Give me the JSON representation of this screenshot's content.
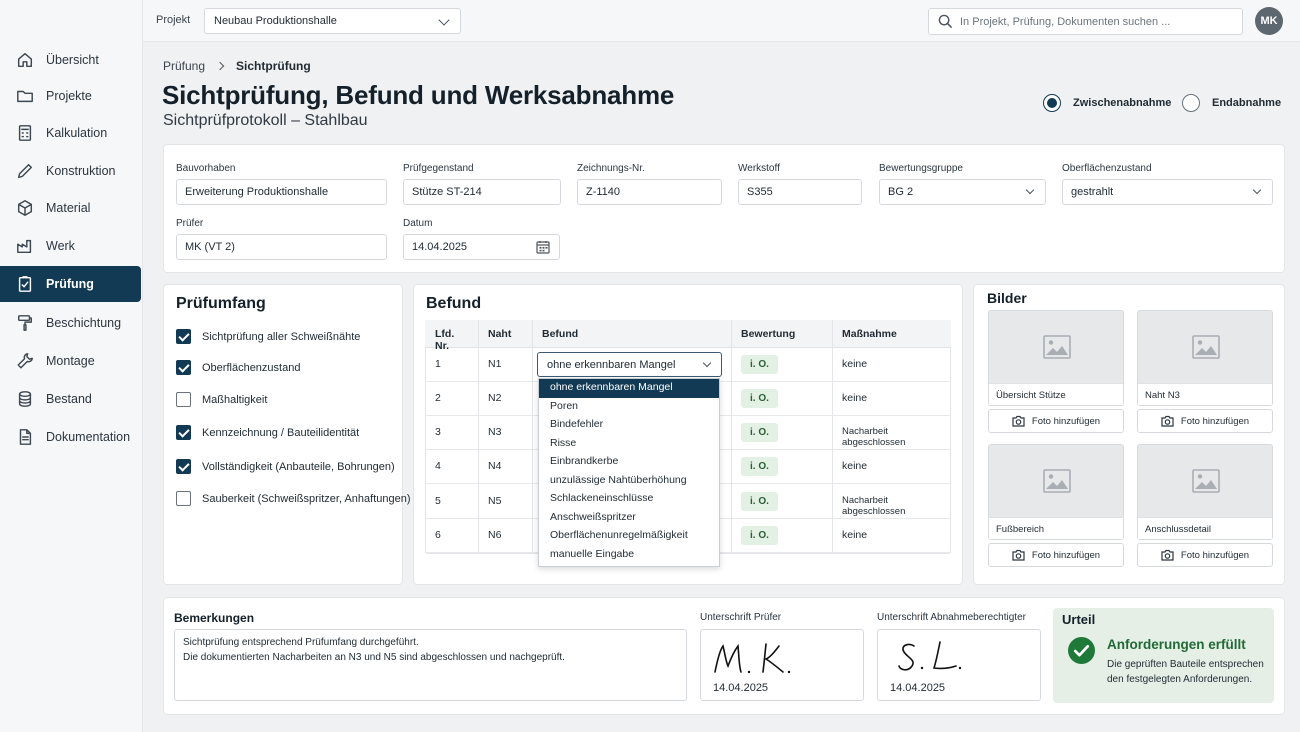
{
  "sidebar": {
    "items": [
      {
        "label": "Übersicht",
        "icon": "home-icon"
      },
      {
        "label": "Projekte",
        "icon": "folder-icon"
      },
      {
        "label": "Kalkulation",
        "icon": "calculator-icon"
      },
      {
        "label": "Konstruktion",
        "icon": "pencil-icon"
      },
      {
        "label": "Material",
        "icon": "cube-icon"
      },
      {
        "label": "Werk",
        "icon": "factory-icon"
      },
      {
        "label": "Prüfung",
        "icon": "clipboard-check-icon"
      },
      {
        "label": "Beschichtung",
        "icon": "paint-roller-icon"
      },
      {
        "label": "Montage",
        "icon": "wrench-icon"
      },
      {
        "label": "Bestand",
        "icon": "database-icon"
      },
      {
        "label": "Dokumentation",
        "icon": "document-icon"
      }
    ],
    "active_index": 6
  },
  "topbar": {
    "project_label": "Projekt",
    "project_value": "Neubau Produktionshalle",
    "search_placeholder": "In Projekt, Prüfung, Dokumenten suchen ...",
    "avatar_initials": "MK"
  },
  "header": {
    "breadcrumb_parent": "Prüfung",
    "breadcrumb_current": "Sichtprüfung",
    "title": "Sichtprüfung, Befund und Werksabnahme",
    "subtitle": "Sichtprüfprotokoll – Stahlbau",
    "radio_options": [
      {
        "label": "Zwischenabnahme",
        "selected": true
      },
      {
        "label": "Endabnahme",
        "selected": false
      }
    ]
  },
  "form": {
    "bauvorhaben_label": "Bauvorhaben",
    "bauvorhaben_value": "Erweiterung Produktionshalle",
    "pruefgegenstand_label": "Prüfgegenstand",
    "pruefgegenstand_value": "Stütze ST-214",
    "zeichnung_label": "Zeichnungs-Nr.",
    "zeichnung_value": "Z-1140",
    "werkstoff_label": "Werkstoff",
    "werkstoff_value": "S355",
    "bewertungsgruppe_label": "Bewertungsgruppe",
    "bewertungsgruppe_value": "BG 2",
    "oberflaeche_label": "Oberflächenzustand",
    "oberflaeche_value": "gestrahlt",
    "pruefer_label": "Prüfer",
    "pruefer_value": "MK (VT 2)",
    "datum_label": "Datum",
    "datum_value": "14.04.2025"
  },
  "scope": {
    "title": "Prüfumfang",
    "items": [
      {
        "label": "Sichtprüfung aller Schweißnähte",
        "checked": true
      },
      {
        "label": "Oberflächenzustand",
        "checked": true
      },
      {
        "label": "Maßhaltigkeit",
        "checked": false
      },
      {
        "label": "Kennzeichnung / Bauteilidentität",
        "checked": true
      },
      {
        "label": "Vollständigkeit (Anbauteile, Bohrungen)",
        "checked": true
      },
      {
        "label": "Sauberkeit (Schweißspritzer, Anhaftungen)",
        "checked": false
      }
    ]
  },
  "befund": {
    "title": "Befund",
    "columns": [
      "Lfd. Nr.",
      "Naht",
      "Befund",
      "Bewertung",
      "Maßnahme"
    ],
    "rows": [
      {
        "nr": "1",
        "naht": "N1",
        "befund": "ohne erkennbaren Mangel",
        "bewertung": "i. O.",
        "massnahme": "keine"
      },
      {
        "nr": "2",
        "naht": "N2",
        "befund": "",
        "bewertung": "i. O.",
        "massnahme": "keine"
      },
      {
        "nr": "3",
        "naht": "N3",
        "befund": "",
        "bewertung": "i. O.",
        "massnahme": "Nacharbeit abgeschlossen"
      },
      {
        "nr": "4",
        "naht": "N4",
        "befund": "",
        "bewertung": "i. O.",
        "massnahme": "keine"
      },
      {
        "nr": "5",
        "naht": "N5",
        "befund": "",
        "bewertung": "i. O.",
        "massnahme": "Nacharbeit abgeschlossen"
      },
      {
        "nr": "6",
        "naht": "N6",
        "befund": "",
        "bewertung": "i. O.",
        "massnahme": "keine"
      }
    ],
    "dropdown_options": [
      "ohne erkennbaren Mangel",
      "Poren",
      "Bindefehler",
      "Risse",
      "Einbrandkerbe",
      "unzulässige Nahtüberhöhung",
      "Schlackeneinschlüsse",
      "Anschweißspritzer",
      "Oberflächenunregelmäßigkeit",
      "manuelle Eingabe"
    ],
    "dropdown_selected": 0
  },
  "images": {
    "title": "Bilder",
    "items": [
      {
        "caption": "Übersicht Stütze"
      },
      {
        "caption": "Naht N3"
      },
      {
        "caption": "Fußbereich"
      },
      {
        "caption": "Anschlussdetail"
      }
    ],
    "add_label": "Foto hinzufügen"
  },
  "bottom": {
    "remarks_title": "Bemerkungen",
    "remarks_line1": "Sichtprüfung entsprechend Prüfumfang durchgeführt.",
    "remarks_line2": "Die dokumentierten Nacharbeiten an N3 und N5 sind abgeschlossen und nachgeprüft.",
    "sig_pruefer_label": "Unterschrift Prüfer",
    "sig_pruefer_date": "14.04.2025",
    "sig_abnahme_label": "Unterschrift Abnahmeberechtigter",
    "sig_abnahme_date": "14.04.2025",
    "verdict_title": "Urteil",
    "verdict_status": "Anforderungen erfüllt",
    "verdict_line1": "Die geprüften Bauteile entsprechen",
    "verdict_line2": "den festgelegten Anforderungen."
  },
  "colors": {
    "primary": "#123a55",
    "success": "#1f7a3a",
    "ok_badge_bg": "#e3f0e4"
  }
}
